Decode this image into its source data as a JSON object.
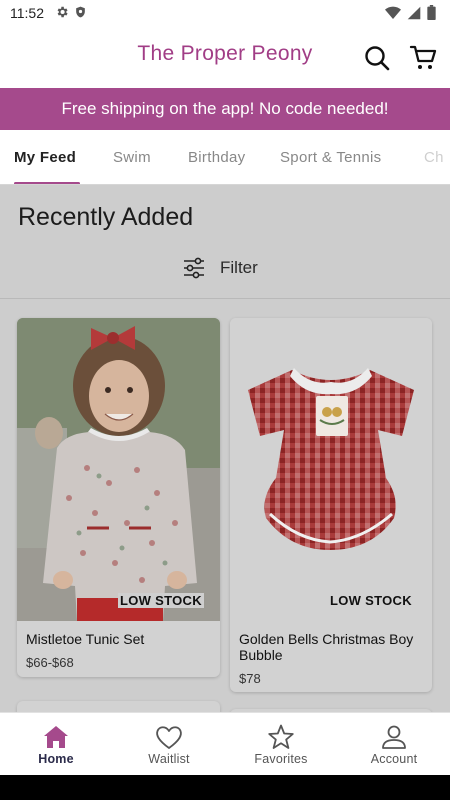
{
  "status_bar": {
    "time": "11:52",
    "icons": [
      "settings-icon",
      "shield-icon",
      "wifi-icon",
      "signal-icon",
      "battery-icon"
    ]
  },
  "app_bar": {
    "title": "The Proper Peony",
    "actions": [
      "search-icon",
      "cart-icon"
    ]
  },
  "banner": {
    "text": "Free shipping on the app! No code needed!"
  },
  "tabs": [
    {
      "label": "My Feed",
      "active": true
    },
    {
      "label": "Swim"
    },
    {
      "label": "Birthday"
    },
    {
      "label": "Sport & Tennis"
    },
    {
      "label": "Ch"
    }
  ],
  "main": {
    "section_title": "Recently Added",
    "filter_label": "Filter",
    "products": [
      {
        "name": "Mistletoe Tunic Set",
        "price": "$66-$68",
        "badge": "LOW STOCK"
      },
      {
        "name": "Golden Bells Christmas Boy Bubble",
        "price": "$78",
        "badge": "LOW STOCK"
      }
    ]
  },
  "bottom_nav": [
    {
      "label": "Home",
      "icon": "home-icon",
      "active": true
    },
    {
      "label": "Waitlist",
      "icon": "heart-icon"
    },
    {
      "label": "Favorites",
      "icon": "star-icon"
    },
    {
      "label": "Account",
      "icon": "person-icon"
    }
  ],
  "colors": {
    "brand": "#a13d86",
    "banner": "#a54a8c",
    "overlay": "#cdcdcd"
  }
}
